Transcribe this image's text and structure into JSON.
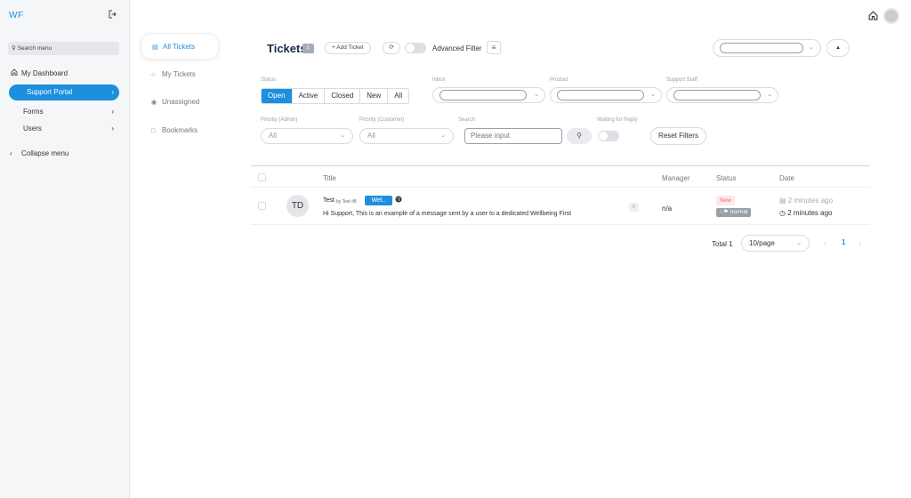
{
  "app": {
    "logo": "WF"
  },
  "icons": {
    "logout": "logout-icon",
    "search": "search-icon",
    "home": "home-icon",
    "chevron_right": "chevron-right-icon",
    "chevron_left": "chevron-left-icon",
    "chevron_down": "chevron-down-icon",
    "list": "list-icon",
    "user": "user-icon",
    "eye": "eye-icon",
    "bookmark": "bookmark-icon",
    "refresh": "refresh-icon",
    "filter": "filter-icon",
    "globe": "globe-icon",
    "clock": "clock-icon",
    "chat": "chat-icon",
    "flag": "flag-icon",
    "caret_up": "caret-up-icon"
  },
  "colors": {
    "accent": "#1c8fde",
    "new_badge_bg": "#fde8ea",
    "new_badge_text": "#f26b7a",
    "priority_badge_bg": "#9aa0a8"
  },
  "sidebar": {
    "search_label": "Search menu",
    "items": [
      {
        "label": "My Dashboard"
      },
      {
        "label": "Support Portal"
      },
      {
        "label": "Forms"
      },
      {
        "label": "Users"
      },
      {
        "label": "Collapse menu"
      }
    ]
  },
  "ticket_nav": [
    {
      "label": "All Tickets"
    },
    {
      "label": "My Tickets"
    },
    {
      "label": "Unassigned"
    },
    {
      "label": "Bookmarks"
    }
  ],
  "header": {
    "title": "Tickets",
    "count": "1",
    "add_ticket": "+ Add Ticket",
    "advanced_filter": "Advanced Filter"
  },
  "filters": {
    "status_label": "Status",
    "status_options": [
      "Open",
      "Active",
      "Closed",
      "New",
      "All"
    ],
    "status_selected": "Open",
    "inbox_label": "Inbox",
    "product_label": "Product",
    "support_staff_label": "Support Staff",
    "priority_admin_label": "Priority (Admin)",
    "priority_admin_value": "All",
    "priority_customer_label": "Priority (Customer)",
    "priority_customer_value": "All",
    "search_label": "Search",
    "search_placeholder": "Please input",
    "waiting_label": "Waiting for Reply",
    "reset_label": "Reset Filters"
  },
  "table": {
    "columns": [
      "Title",
      "Manager",
      "Status",
      "Date"
    ],
    "rows": [
      {
        "avatar_initials": "TD",
        "title": "Test",
        "by": "by Test #8",
        "tag": "Wel..",
        "message": "Hi Support, This is an example of a message sent by a user to a dedicated Wellbeing First",
        "reply_count": "0",
        "manager": "n/a",
        "status": "New",
        "priority": "normal",
        "date_updated": "2 minutes ago",
        "date_created": "2 minutes ago"
      }
    ]
  },
  "pagination": {
    "total": "Total 1",
    "page_size": "10/page",
    "current_page": "1"
  }
}
